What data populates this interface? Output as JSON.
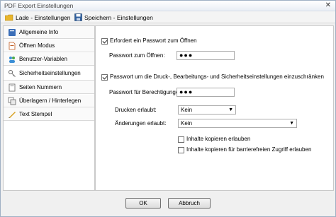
{
  "window": {
    "title": "PDF Export Einstellungen",
    "close_glyph": "✕"
  },
  "toolbar": {
    "load_label": "Lade - Einstellungen",
    "save_label": "Speichern - Einstellungen"
  },
  "sidebar": {
    "items": [
      {
        "label": "Allgemeine Info",
        "icon": "book-icon"
      },
      {
        "label": "Öffnen Modus",
        "icon": "document-icon"
      },
      {
        "label": "Benutzer-Variablen",
        "icon": "users-icon"
      },
      {
        "label": "Sicherheitseinstellungen",
        "icon": "key-icon",
        "selected": true
      },
      {
        "label": "Seiten Nummern",
        "icon": "page-icon"
      },
      {
        "label": "Überlagern / Hinterlegen",
        "icon": "layers-icon"
      },
      {
        "label": "Text Stempel",
        "icon": "stamp-icon"
      }
    ]
  },
  "security": {
    "open_password_checkbox": "Erfordert ein Passwort zum Öffnen",
    "open_password_checked": true,
    "open_password_label": "Passwort zum Öffnen:",
    "open_password_value": "●●●",
    "permissions_checkbox": "Passwort um die Druck-, Bearbeitungs- und Sicherheitseinstellungen einzuschränken",
    "permissions_checked": true,
    "permissions_password_label": "Passwort für Berechtigungen:",
    "permissions_password_value": "●●●",
    "print_label": "Drucken erlaubt:",
    "print_value": "Kein",
    "changes_label": "Änderungen erlaubt:",
    "changes_value": "Kein",
    "copy_content_label": "Inhalte kopieren erlauben",
    "copy_content_checked": false,
    "copy_accessible_label": "Inhalte kopieren für barrierefreien Zugriff erlauben",
    "copy_accessible_checked": false,
    "dropdown_arrow": "▼"
  },
  "footer": {
    "ok_label": "OK",
    "cancel_label": "Abbruch"
  },
  "colors": {
    "accent": "#1e5aa0",
    "folder": "#e8b52c"
  }
}
